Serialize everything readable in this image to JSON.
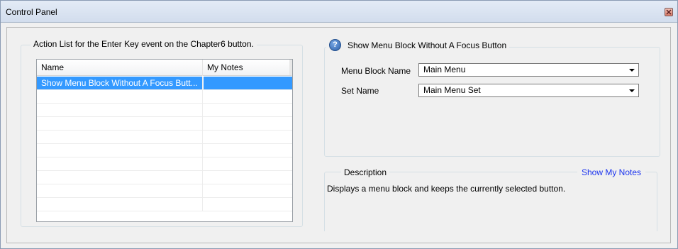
{
  "window": {
    "title": "Control Panel"
  },
  "action_list": {
    "legend": "Action List for the Enter Key event on the Chapter6 button.",
    "columns": [
      "Name",
      "My Notes"
    ],
    "rows": [
      {
        "name": "Show Menu Block Without A Focus Butt...",
        "notes": "",
        "selected": true
      },
      {
        "name": "",
        "notes": ""
      },
      {
        "name": "",
        "notes": ""
      },
      {
        "name": "",
        "notes": ""
      },
      {
        "name": "",
        "notes": ""
      },
      {
        "name": "",
        "notes": ""
      },
      {
        "name": "",
        "notes": ""
      },
      {
        "name": "",
        "notes": ""
      },
      {
        "name": "",
        "notes": ""
      },
      {
        "name": "",
        "notes": ""
      }
    ]
  },
  "properties": {
    "icon": "help-icon",
    "title": "Show Menu Block Without A Focus Button",
    "menu_block_label": "Menu Block Name",
    "menu_block_value": "Main Menu",
    "set_name_label": "Set Name",
    "set_name_value": "Main Menu Set"
  },
  "description": {
    "legend": "Description",
    "show_notes_link": "Show My Notes",
    "text": "Displays a menu block and keeps the currently selected button."
  },
  "colors": {
    "selection": "#3399ff",
    "link": "#1a33ee"
  }
}
